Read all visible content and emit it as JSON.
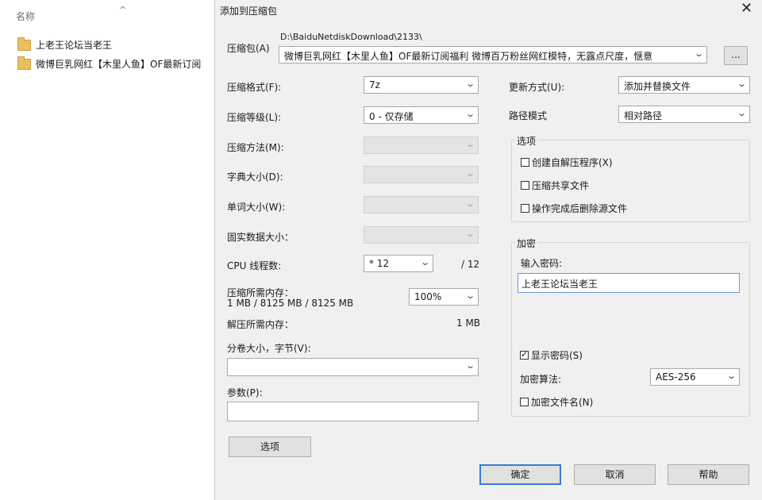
{
  "explorer": {
    "column_header": "名称",
    "sort_glyph": "^",
    "files": [
      "上老王论坛当老王",
      "微博巨乳网红【木里人鱼】OF最新订阅"
    ]
  },
  "dialog": {
    "title": "添加到压缩包",
    "close_glyph": "✕",
    "archive": {
      "label": "压缩包(A)",
      "path": "D:\\BaiduNetdiskDownload\\2133\\",
      "name": "微博巨乳网红【木里人鱼】OF最新订阅福利 微博百万粉丝网红模特，无露点尺度，惬意",
      "browse_label": "..."
    },
    "format": {
      "label": "压缩格式(F):",
      "value": "7z"
    },
    "level": {
      "label": "压缩等级(L):",
      "value": "0 - 仅存储"
    },
    "method": {
      "label": "压缩方法(M):",
      "value": ""
    },
    "dict": {
      "label": "字典大小(D):",
      "value": ""
    },
    "word": {
      "label": "单词大小(W):",
      "value": ""
    },
    "solid": {
      "label": "固实数据大小：",
      "value": ""
    },
    "cpu": {
      "label": "CPU 线程数:",
      "value": "* 12",
      "max": "/ 12"
    },
    "mem_compress": {
      "label": "压缩所需内存：",
      "detail": "1 MB / 8125 MB / 8125 MB",
      "percent": "100%"
    },
    "mem_decompress": {
      "label": "解压所需内存：",
      "value": "1 MB"
    },
    "volume": {
      "label": "分卷大小，字节(V):",
      "value": ""
    },
    "params": {
      "label": "参数(P):",
      "value": ""
    },
    "options_button": "选项",
    "update": {
      "label": "更新方式(U):",
      "value": "添加并替换文件"
    },
    "pathmode": {
      "label": "路径模式",
      "value": "相对路径"
    },
    "options_group": {
      "title": "选项",
      "sfx": "创建自解压程序(X)",
      "shared": "压缩共享文件",
      "delete_after": "操作完成后删除源文件"
    },
    "encryption": {
      "title": "加密",
      "password_label": "输入密码:",
      "password_value": "上老王论坛当老王",
      "show_password": "显示密码(S)",
      "method_label": "加密算法:",
      "method_value": "AES-256",
      "encrypt_names": "加密文件名(N)"
    },
    "buttons": {
      "ok": "确定",
      "cancel": "取消",
      "help": "帮助"
    }
  }
}
